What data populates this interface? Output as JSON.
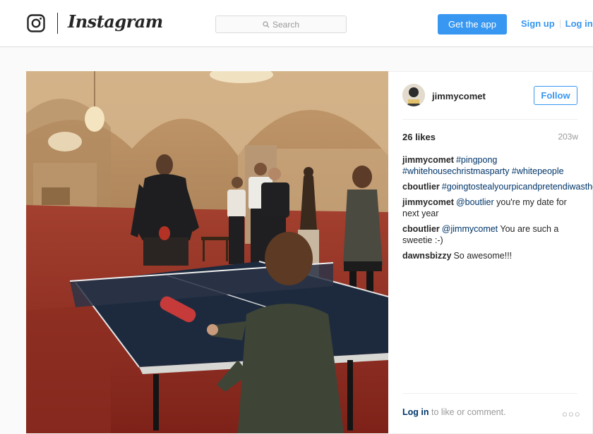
{
  "header": {
    "brand": "Instagram",
    "search_placeholder": "Search",
    "get_app": "Get the app",
    "sign_up": "Sign up",
    "log_in": "Log in"
  },
  "post": {
    "username": "jimmycomet",
    "follow": "Follow",
    "likes": "26 likes",
    "time_ago": "203w",
    "comments": [
      {
        "user": "jimmycomet",
        "text": "#pingpong #whitehousechristmasparty #whitepeople"
      },
      {
        "user": "cboutlier",
        "text": "#goingtostealyourpicandpretendiwasthere"
      },
      {
        "user": "jimmycomet",
        "mention": "@boutlier",
        "text": "you're my date for next year"
      },
      {
        "user": "cboutlier",
        "mention": "@jimmycomet",
        "text": "You are such a sweetie :-)"
      },
      {
        "user": "dawnsbizzy",
        "text": "So awesome!!!"
      }
    ],
    "login_link": "Log in",
    "login_rest": "to like or comment.",
    "more": "○○○"
  },
  "colors": {
    "accent": "#3897f0",
    "link_dark": "#003569",
    "muted": "#999999",
    "border": "#dbdbdb"
  }
}
